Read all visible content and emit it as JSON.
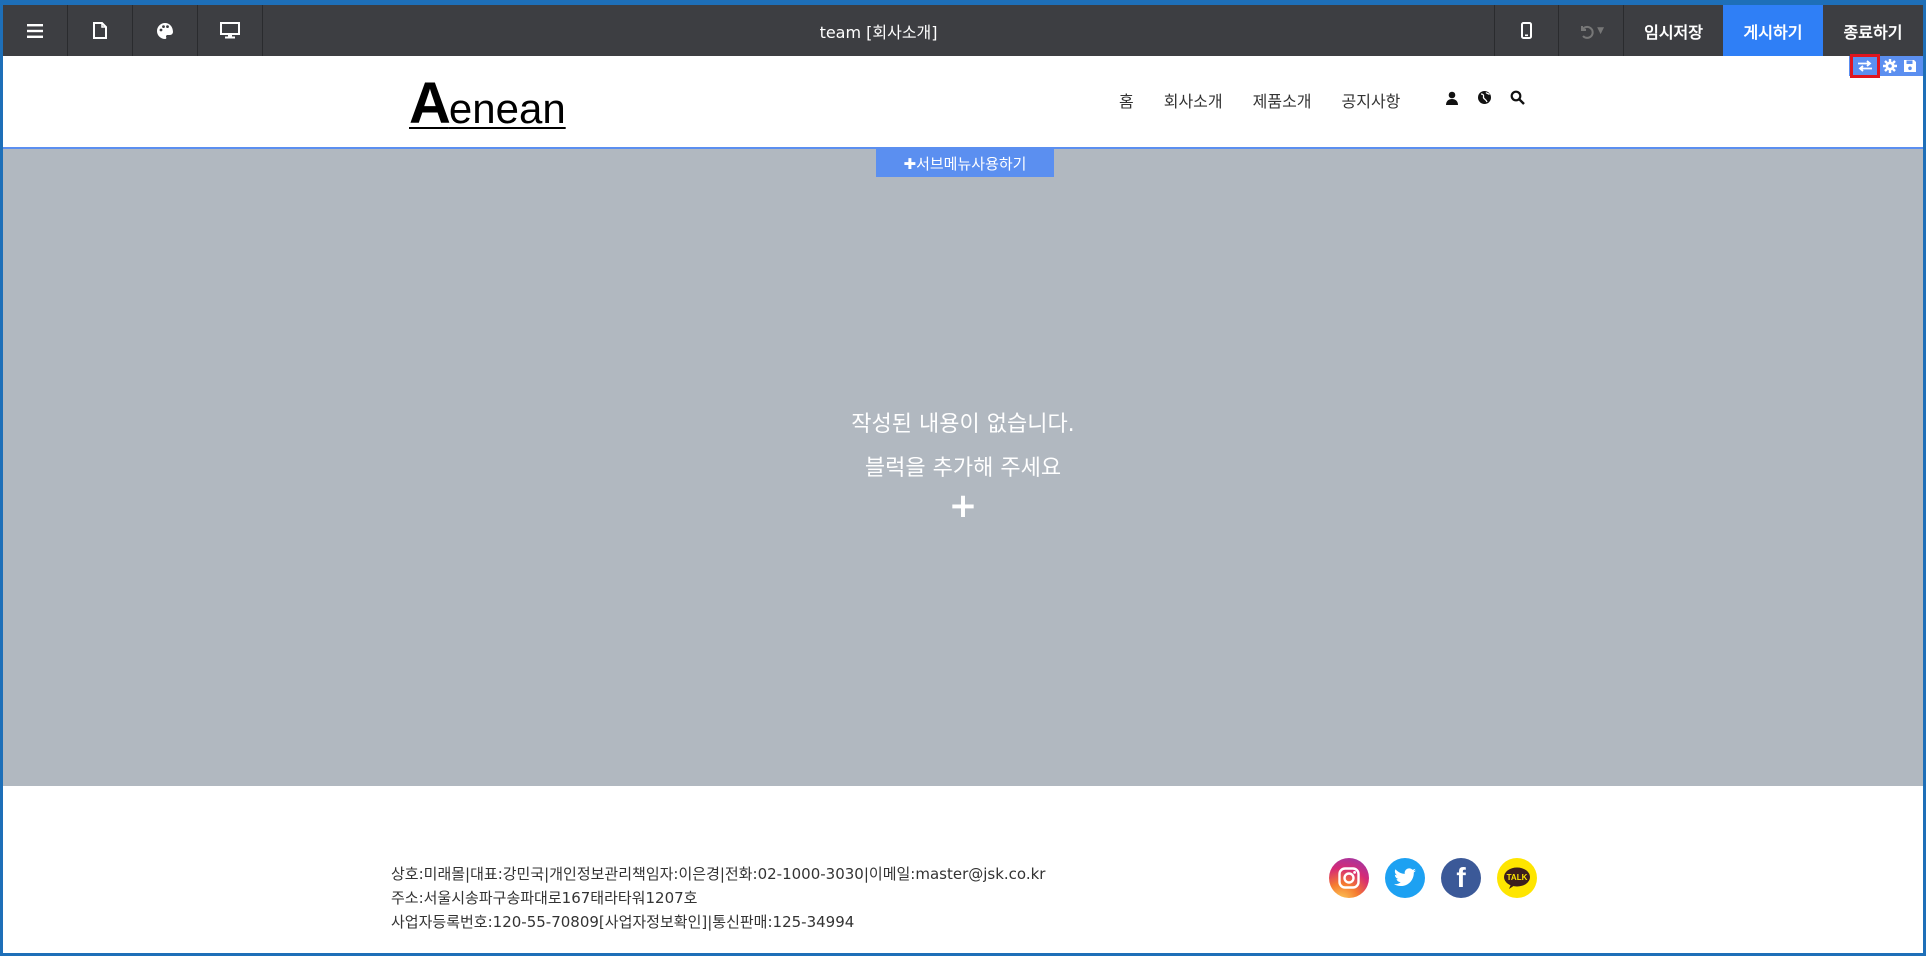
{
  "toolbar": {
    "title": "team [회사소개]",
    "icons": [
      "menu-icon",
      "page-icon",
      "palette-icon",
      "desktop-icon"
    ],
    "device_icon": "mobile-icon",
    "undo_icon": "undo-icon",
    "temp_save_label": "임시저장",
    "publish_label": "게시하기",
    "exit_label": "종료하기",
    "publish_color": "#2f7ff6"
  },
  "header": {
    "logo_first": "A",
    "logo_rest": "enean",
    "nav": [
      "홈",
      "회사소개",
      "제품소개",
      "공지사항"
    ],
    "nav_icons": [
      "user-icon",
      "globe-icon",
      "search-icon"
    ],
    "edit_tools": [
      "swap-icon",
      "gear-icon",
      "save-icon"
    ]
  },
  "content": {
    "submenu_label": "✚서브메뉴사용하기",
    "empty_line1": "작성된 내용이 없습니다.",
    "empty_line2": "블럭을 추가해 주세요",
    "add_symbol": "+",
    "bg_color": "#b1b8c0"
  },
  "footer": {
    "line1": "상호:미래몰|대표:강민국|개인정보관리책임자:이은경|전화:02-1000-3030|이메일:master@jsk.co.kr",
    "line2": "주소:서울시송파구송파대로167태라타워1207호",
    "line3": "사업자등록번호:120-55-70809[사업자정보확인]|통신판매:125-34994",
    "socials": [
      "instagram-icon",
      "twitter-icon",
      "facebook-icon",
      "kakaotalk-icon"
    ],
    "kakao_label": "TALK",
    "facebook_label": "f"
  }
}
